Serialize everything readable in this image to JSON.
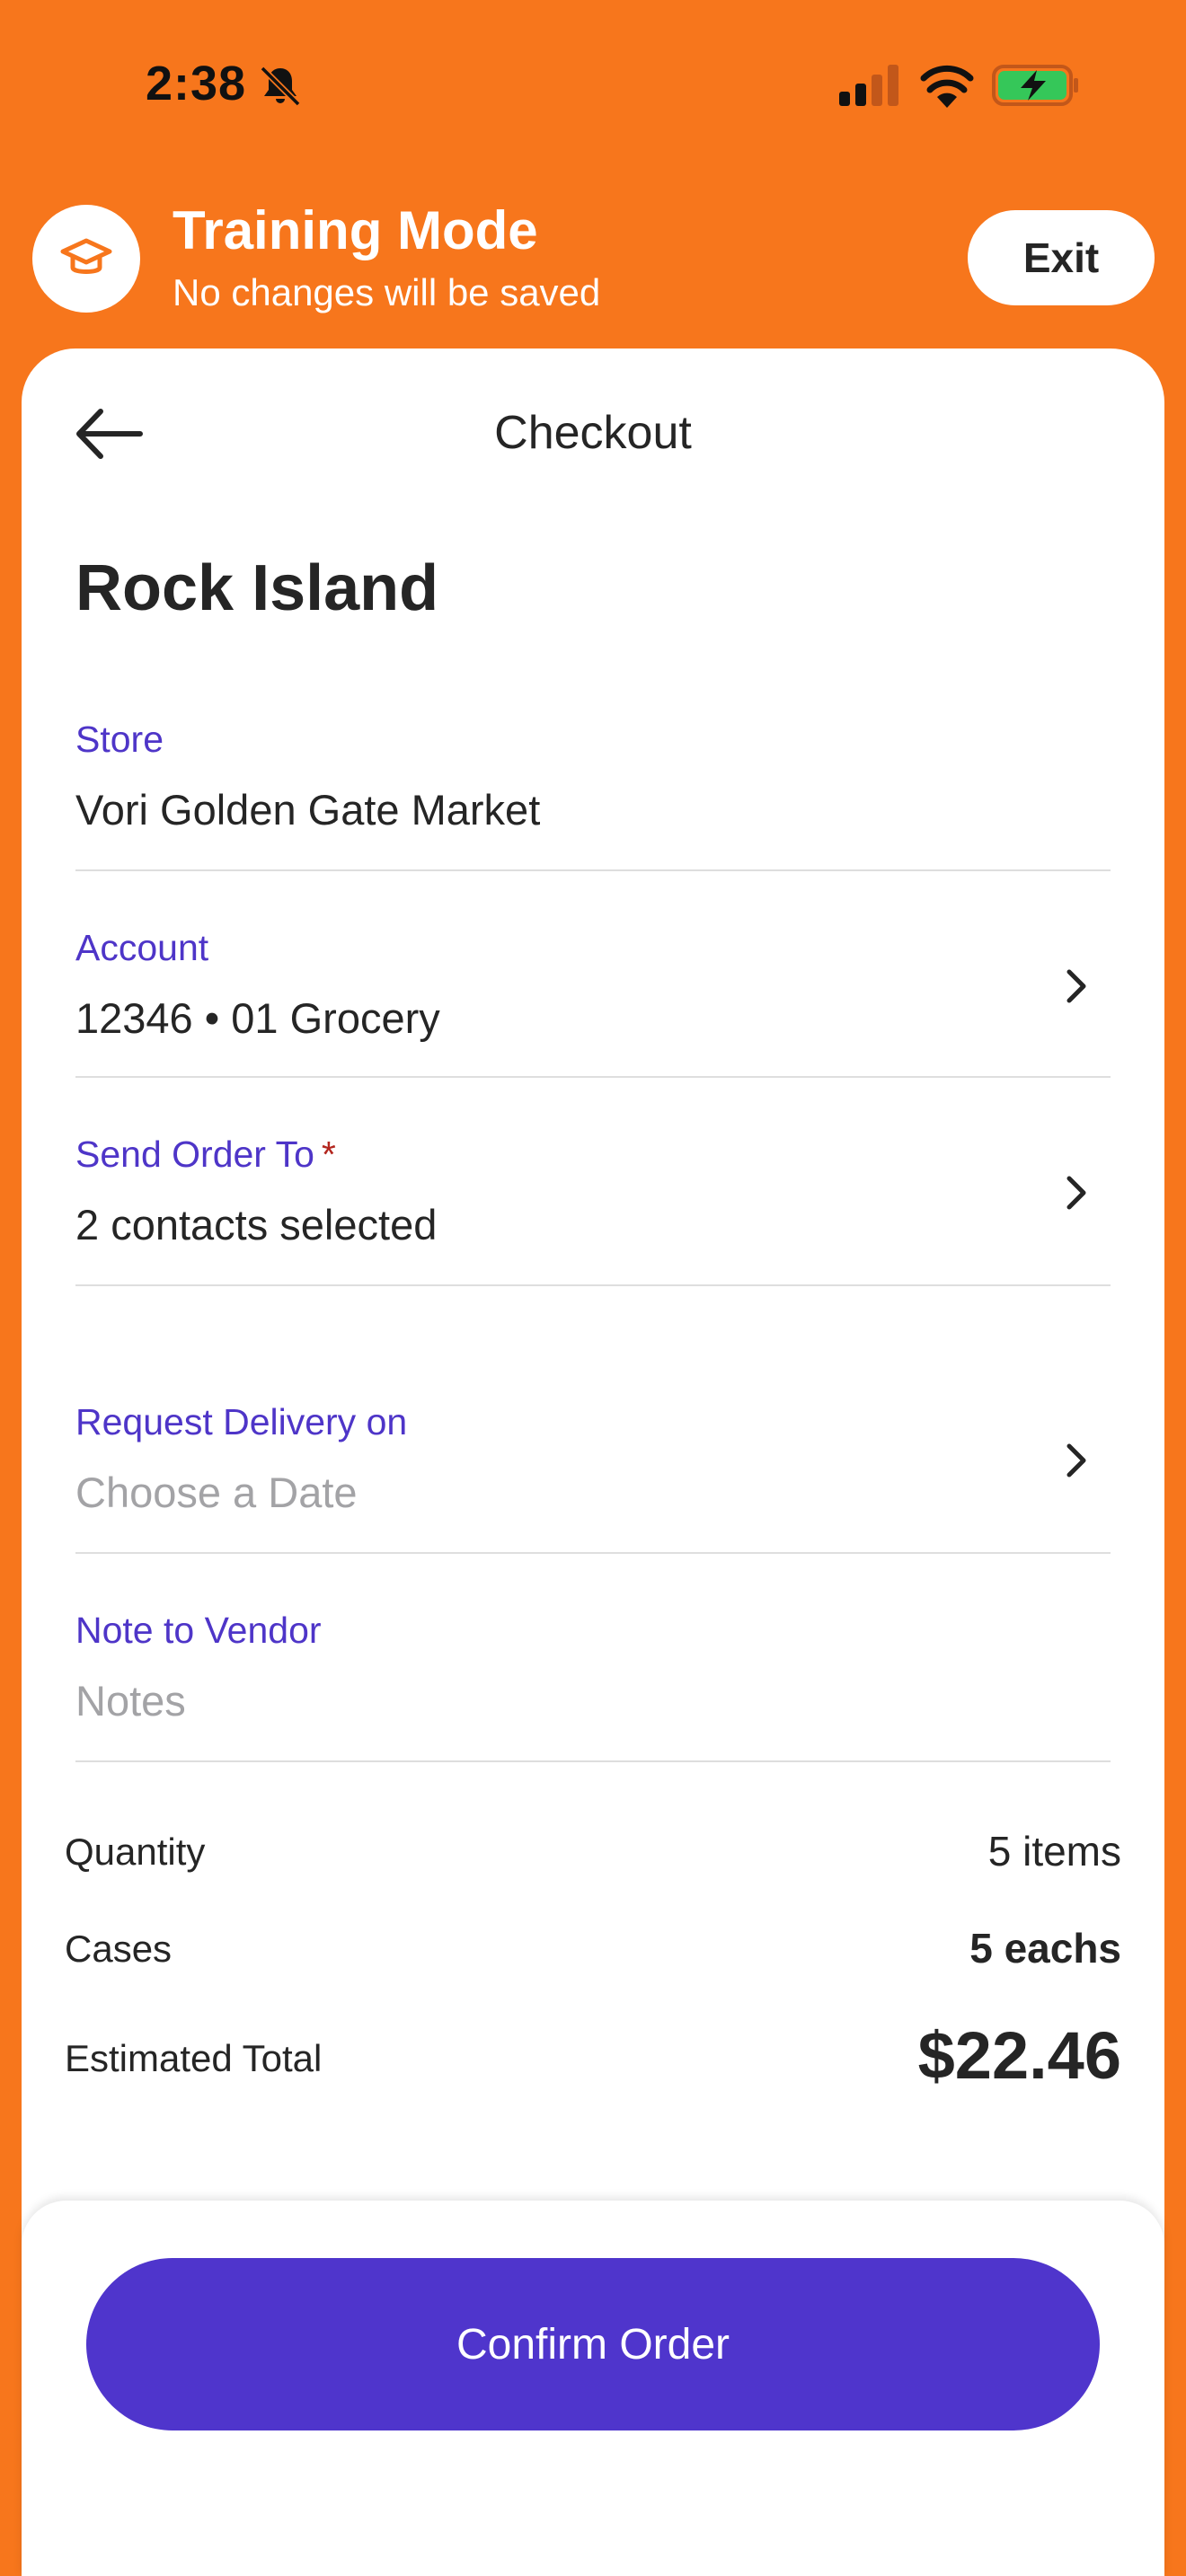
{
  "status_bar": {
    "time": "2:38",
    "icons": [
      "bell-slash-icon",
      "cellular-signal-icon",
      "wifi-icon",
      "battery-charging-icon"
    ]
  },
  "training_banner": {
    "title": "Training Mode",
    "subtitle": "No changes will be saved",
    "exit_label": "Exit",
    "icon": "graduation-cap-icon"
  },
  "header": {
    "title": "Checkout",
    "back_icon": "arrow-left-icon"
  },
  "vendor": {
    "name": "Rock Island"
  },
  "fields": {
    "store": {
      "label": "Store",
      "value": "Vori Golden Gate Market"
    },
    "account": {
      "label": "Account",
      "value": "12346 • 01 Grocery"
    },
    "send_order_to": {
      "label": "Send Order To",
      "required_mark": "*",
      "value": "2 contacts selected"
    },
    "delivery": {
      "label": "Request Delivery on",
      "placeholder": "Choose a Date"
    },
    "note": {
      "label": "Note to Vendor",
      "placeholder": "Notes"
    }
  },
  "summary": {
    "quantity_label": "Quantity",
    "quantity_value": "5 items",
    "cases_label": "Cases",
    "cases_value": "5 eachs",
    "total_label": "Estimated Total",
    "total_value": "$22.46"
  },
  "footer": {
    "confirm_label": "Confirm Order"
  },
  "colors": {
    "brand_orange": "#F7761C",
    "label_purple": "#4E35C8",
    "button_purple": "#4F35CC",
    "required_red": "#B3261E",
    "placeholder_gray": "#A3A3A6"
  }
}
